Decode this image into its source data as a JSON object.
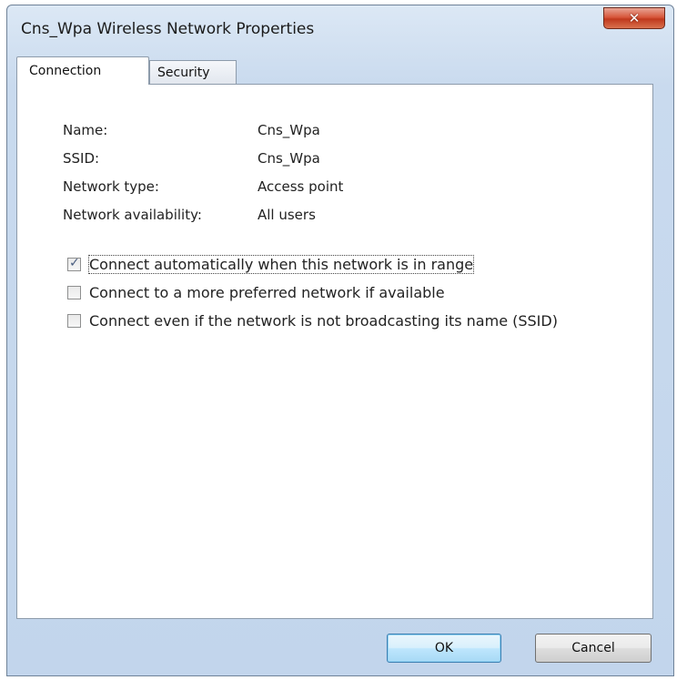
{
  "window": {
    "title": "Cns_Wpa Wireless Network Properties",
    "close_icon": "close-x-icon",
    "close_glyph": "✕"
  },
  "tabs": [
    {
      "label": "Connection",
      "selected": true
    },
    {
      "label": "Security",
      "selected": false
    }
  ],
  "properties": [
    {
      "key": "Name:",
      "value": "Cns_Wpa"
    },
    {
      "key": "SSID:",
      "value": "Cns_Wpa"
    },
    {
      "key": "Network type:",
      "value": "Access point"
    },
    {
      "key": "Network availability:",
      "value": "All users"
    }
  ],
  "options": [
    {
      "label": "Connect automatically when this network is in range",
      "checked": true
    },
    {
      "label": "Connect to a more preferred network if available",
      "checked": false
    },
    {
      "label": "Connect even if the network is not broadcasting its name (SSID)",
      "checked": false
    }
  ],
  "buttons": {
    "ok": "OK",
    "cancel": "Cancel"
  },
  "colors": {
    "frame": "#c2d5ec",
    "close_button": "#c0391d",
    "default_button": "#a7d9f5"
  }
}
